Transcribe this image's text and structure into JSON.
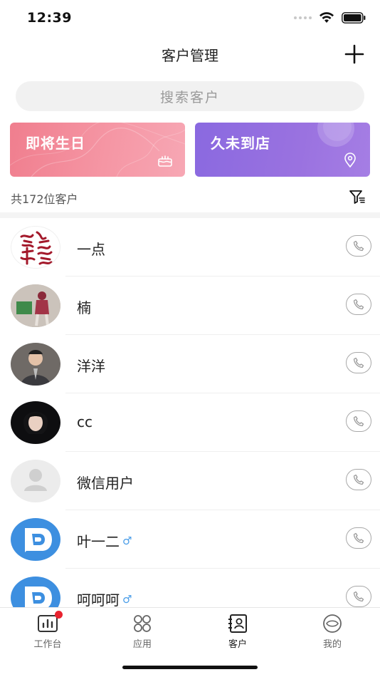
{
  "status_bar": {
    "time": "12:39"
  },
  "nav": {
    "title": "客户管理",
    "add_icon": "plus-icon"
  },
  "search": {
    "placeholder": "搜索客户"
  },
  "cards": [
    {
      "label": "即将生日",
      "icon": "cake-icon",
      "color": "#f07e8e"
    },
    {
      "label": "久未到店",
      "icon": "location-pin-icon",
      "color": "#8a69e0"
    }
  ],
  "summary": {
    "count_text": "共172位客户",
    "filter_icon": "filter-icon"
  },
  "customers": [
    {
      "name": "一点",
      "avatar": "calligraphy-avatar",
      "male": false
    },
    {
      "name": "楠",
      "avatar": "photo-avatar",
      "male": false
    },
    {
      "name": "洋洋",
      "avatar": "photo-avatar",
      "male": false
    },
    {
      "name": "cc",
      "avatar": "photo-avatar",
      "male": false
    },
    {
      "name": "微信用户",
      "avatar": "default-user-avatar",
      "male": false
    },
    {
      "name": "叶一二",
      "avatar": "app-logo-avatar",
      "male": true
    },
    {
      "name": "呵呵呵",
      "avatar": "app-logo-avatar",
      "male": true
    }
  ],
  "male_symbol": "♂",
  "tabs": [
    {
      "label": "工作台",
      "icon": "dashboard-icon",
      "badge": true
    },
    {
      "label": "应用",
      "icon": "apps-grid-icon",
      "badge": false
    },
    {
      "label": "客户",
      "icon": "customer-card-icon",
      "active": true
    },
    {
      "label": "我的",
      "icon": "profile-eye-icon",
      "badge": false
    }
  ]
}
